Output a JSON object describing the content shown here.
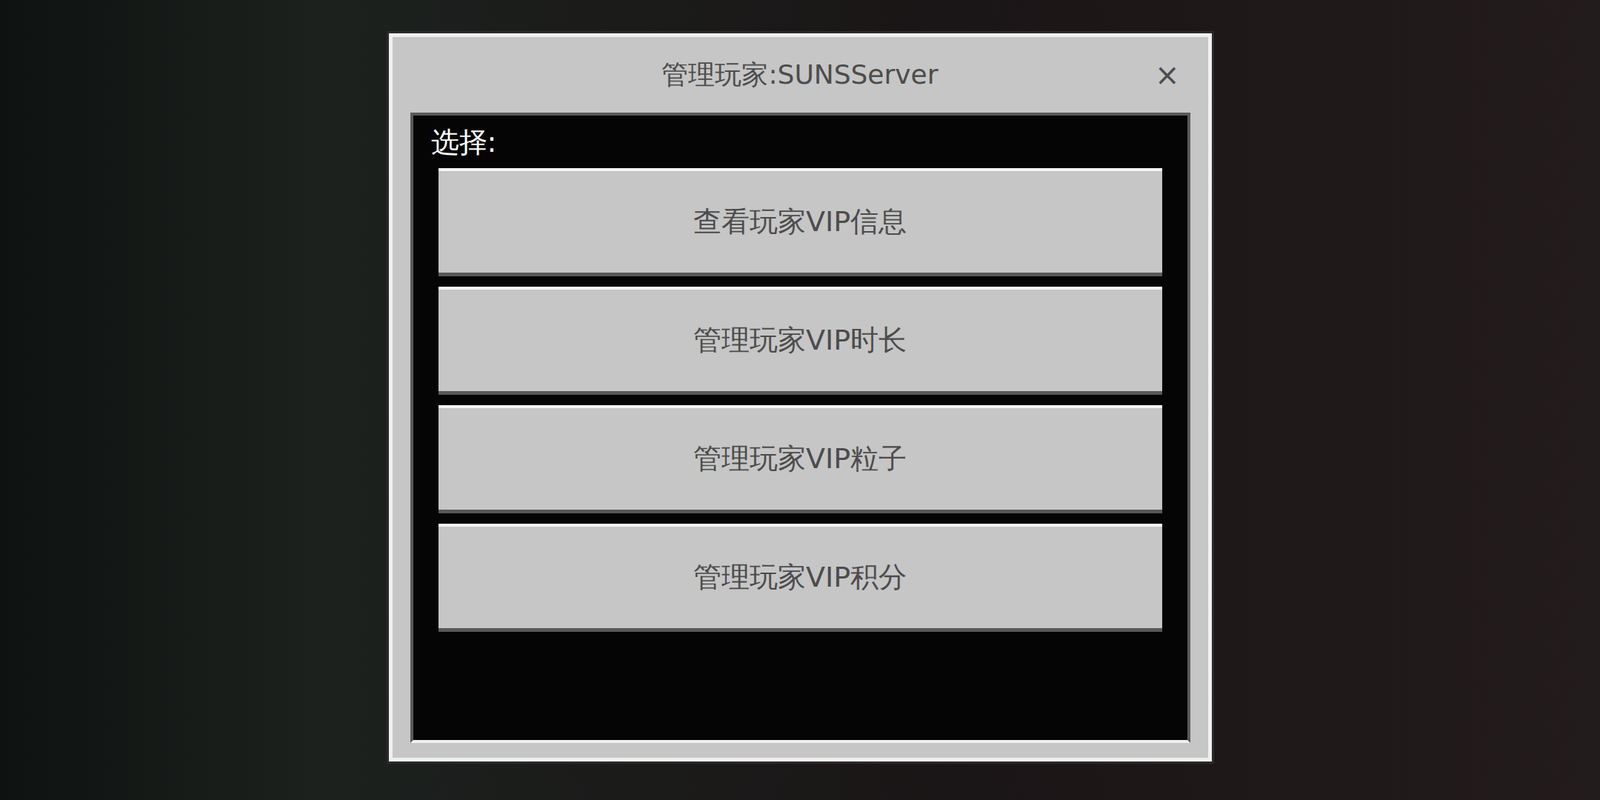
{
  "dialog": {
    "title": "管理玩家:SUNSServer",
    "close": "×"
  },
  "prompt": "选择:",
  "buttons": [
    {
      "label": "查看玩家VIP信息"
    },
    {
      "label": "管理玩家VIP时长"
    },
    {
      "label": "管理玩家VIP粒子"
    },
    {
      "label": "管理玩家VIP积分"
    }
  ]
}
